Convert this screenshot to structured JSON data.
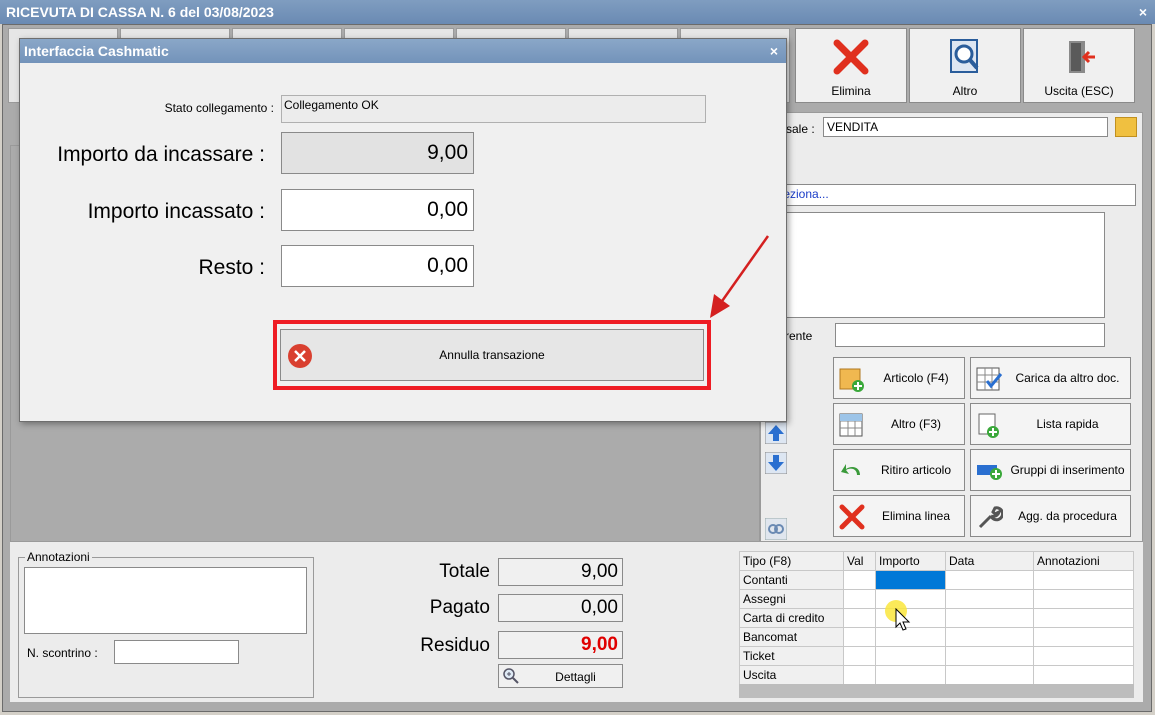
{
  "window": {
    "title": "RICEVUTA DI CASSA N. 6 del 03/08/2023",
    "close": "×"
  },
  "toolbar": {
    "elimina": "Elimina",
    "altro": "Altro",
    "uscita": "Uscita (ESC)"
  },
  "causale": {
    "label": "sale :",
    "value": "VENDITA"
  },
  "seleziona": "eleziona...",
  "riferente_label": "ferente",
  "side_buttons": {
    "articolo": "Articolo (F4)",
    "carica": "Carica da altro doc.",
    "altro": "Altro (F3)",
    "lista": "Lista rapida",
    "ritiro": "Ritiro articolo",
    "gruppi": "Gruppi di inserimento",
    "elimina_linea": "Elimina linea",
    "agg": "Agg. da procedura"
  },
  "annotazioni": {
    "label": "Annotazioni",
    "scontrino_label": "N. scontrino :"
  },
  "totals": {
    "totale_label": "Totale",
    "totale": "9,00",
    "pagato_label": "Pagato",
    "pagato": "0,00",
    "residuo_label": "Residuo",
    "residuo": "9,00",
    "dettagli": "Dettagli"
  },
  "payments": {
    "headers": [
      "Tipo (F8)",
      "Val",
      "Importo",
      "Data",
      "Annotazioni"
    ],
    "rows": [
      "Contanti",
      "Assegni",
      "Carta di credito",
      "Bancomat",
      "Ticket",
      "Uscita"
    ]
  },
  "dialog": {
    "title": "Interfaccia Cashmatic",
    "close": "×",
    "stato_label": "Stato collegamento :",
    "stato_value": "Collegamento OK",
    "da_incassare_label": "Importo da incassare :",
    "da_incassare": "9,00",
    "incassato_label": "Importo incassato :",
    "incassato": "0,00",
    "resto_label": "Resto :",
    "resto": "0,00",
    "annulla": "Annulla transazione"
  },
  "colors": {
    "accent_red": "#ee1c24",
    "selected_cell": "#0078d7",
    "residuo_red": "#e00000"
  }
}
